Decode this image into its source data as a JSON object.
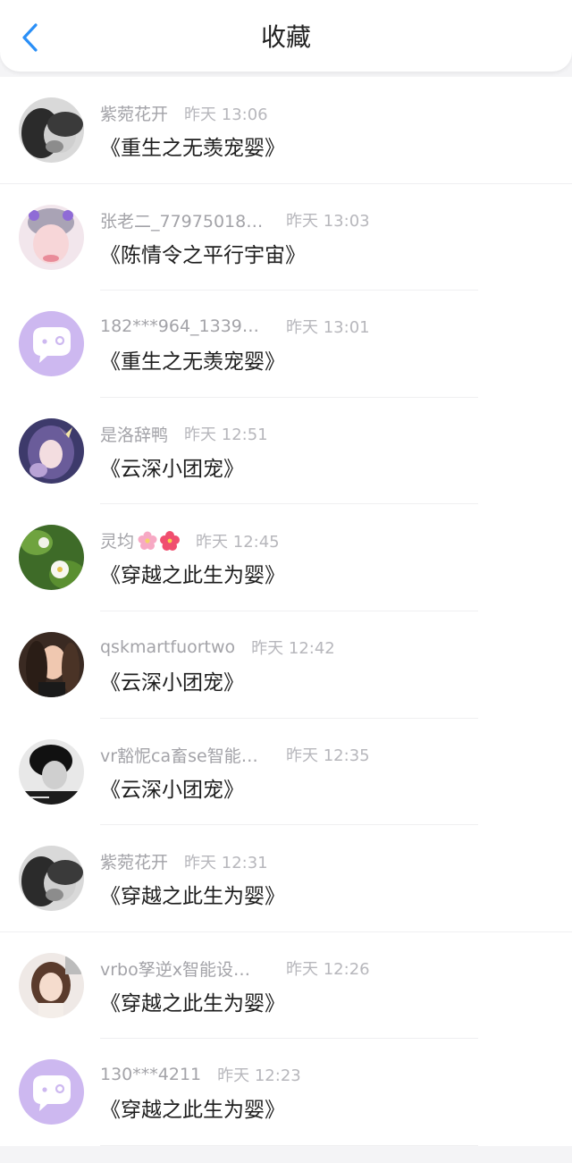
{
  "header": {
    "title": "收藏",
    "back_icon": "chevron-left-icon",
    "accent": "#2a8ff7"
  },
  "items": [
    {
      "name": "紫菀花开",
      "time": "昨天 13:06",
      "story": "《重生之无羡宠婴》",
      "avatar": "photo"
    },
    {
      "name": "张老二_77975018…",
      "time": "昨天 13:03",
      "story": "《陈情令之平行宇宙》",
      "avatar": "photo"
    },
    {
      "name": "182***964_1339…",
      "time": "昨天 13:01",
      "story": "《重生之无羡宠婴》",
      "avatar": "default-chat-bubble"
    },
    {
      "name": "是洛辞鸭",
      "time": "昨天 12:51",
      "story": "《云深小团宠》",
      "avatar": "photo"
    },
    {
      "name": "灵均",
      "time": "昨天 12:45",
      "story": "《穿越之此生为婴》",
      "avatar": "photo",
      "name_emoji": [
        "pink-flower-icon",
        "hibiscus-icon"
      ]
    },
    {
      "name": "qskmartfuortwo",
      "time": "昨天 12:42",
      "story": "《云深小团宠》",
      "avatar": "photo"
    },
    {
      "name": "vr豁怩ca畜se智能…",
      "time": "昨天 12:35",
      "story": "《云深小团宠》",
      "avatar": "photo"
    },
    {
      "name": "紫菀花开",
      "time": "昨天 12:31",
      "story": "《穿越之此生为婴》",
      "avatar": "photo"
    },
    {
      "name": "vrbo孥逆x智能设…",
      "time": "昨天 12:26",
      "story": "《穿越之此生为婴》",
      "avatar": "photo"
    },
    {
      "name": "130***4211",
      "time": "昨天 12:23",
      "story": "《穿越之此生为婴》",
      "avatar": "default-chat-bubble"
    }
  ]
}
